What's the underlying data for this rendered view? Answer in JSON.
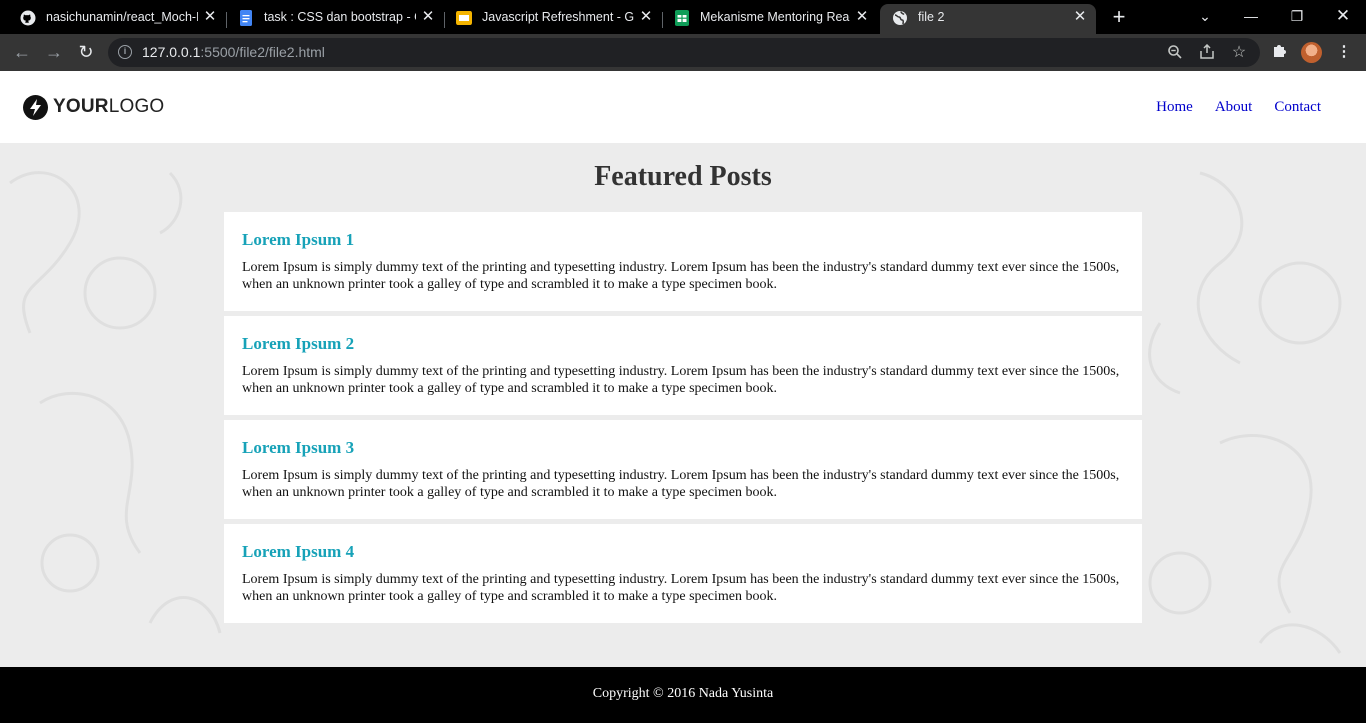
{
  "browser": {
    "tabs": [
      {
        "title": "nasichunamin/react_Moch-N",
        "favicon": "github-icon"
      },
      {
        "title": "task : CSS dan bootstrap - Go",
        "favicon": "google-docs-icon",
        "color": "#4285f4"
      },
      {
        "title": "Javascript Refreshment - Goo",
        "favicon": "google-slides-icon",
        "color": "#f4b400"
      },
      {
        "title": "Mekanisme Mentoring React",
        "favicon": "google-sheets-icon",
        "color": "#0f9d58"
      },
      {
        "title": "file 2",
        "favicon": "globe-icon",
        "active": true
      }
    ],
    "url_host": "127.0.0.1",
    "url_rest": ":5500/file2/file2.html"
  },
  "site": {
    "logo_bold": "YOUR",
    "logo_light": "LOGO",
    "nav": [
      "Home",
      "About",
      "Contact"
    ],
    "section_title": "Featured Posts",
    "posts": [
      {
        "title": "Lorem Ipsum 1",
        "body": "Lorem Ipsum is simply dummy text of the printing and typesetting industry. Lorem Ipsum has been the industry's standard dummy text ever since the 1500s, when an unknown printer took a galley of type and scrambled it to make a type specimen book."
      },
      {
        "title": "Lorem Ipsum 2",
        "body": "Lorem Ipsum is simply dummy text of the printing and typesetting industry. Lorem Ipsum has been the industry's standard dummy text ever since the 1500s, when an unknown printer took a galley of type and scrambled it to make a type specimen book."
      },
      {
        "title": "Lorem Ipsum 3",
        "body": "Lorem Ipsum is simply dummy text of the printing and typesetting industry. Lorem Ipsum has been the industry's standard dummy text ever since the 1500s, when an unknown printer took a galley of type and scrambled it to make a type specimen book."
      },
      {
        "title": "Lorem Ipsum 4",
        "body": "Lorem Ipsum is simply dummy text of the printing and typesetting industry. Lorem Ipsum has been the industry's standard dummy text ever since the 1500s, when an unknown printer took a galley of type and scrambled it to make a type specimen book."
      }
    ],
    "footer": "Copyright © 2016 Nada Yusinta",
    "accent_color": "#17a2b8",
    "nav_color": "#0000cc"
  }
}
